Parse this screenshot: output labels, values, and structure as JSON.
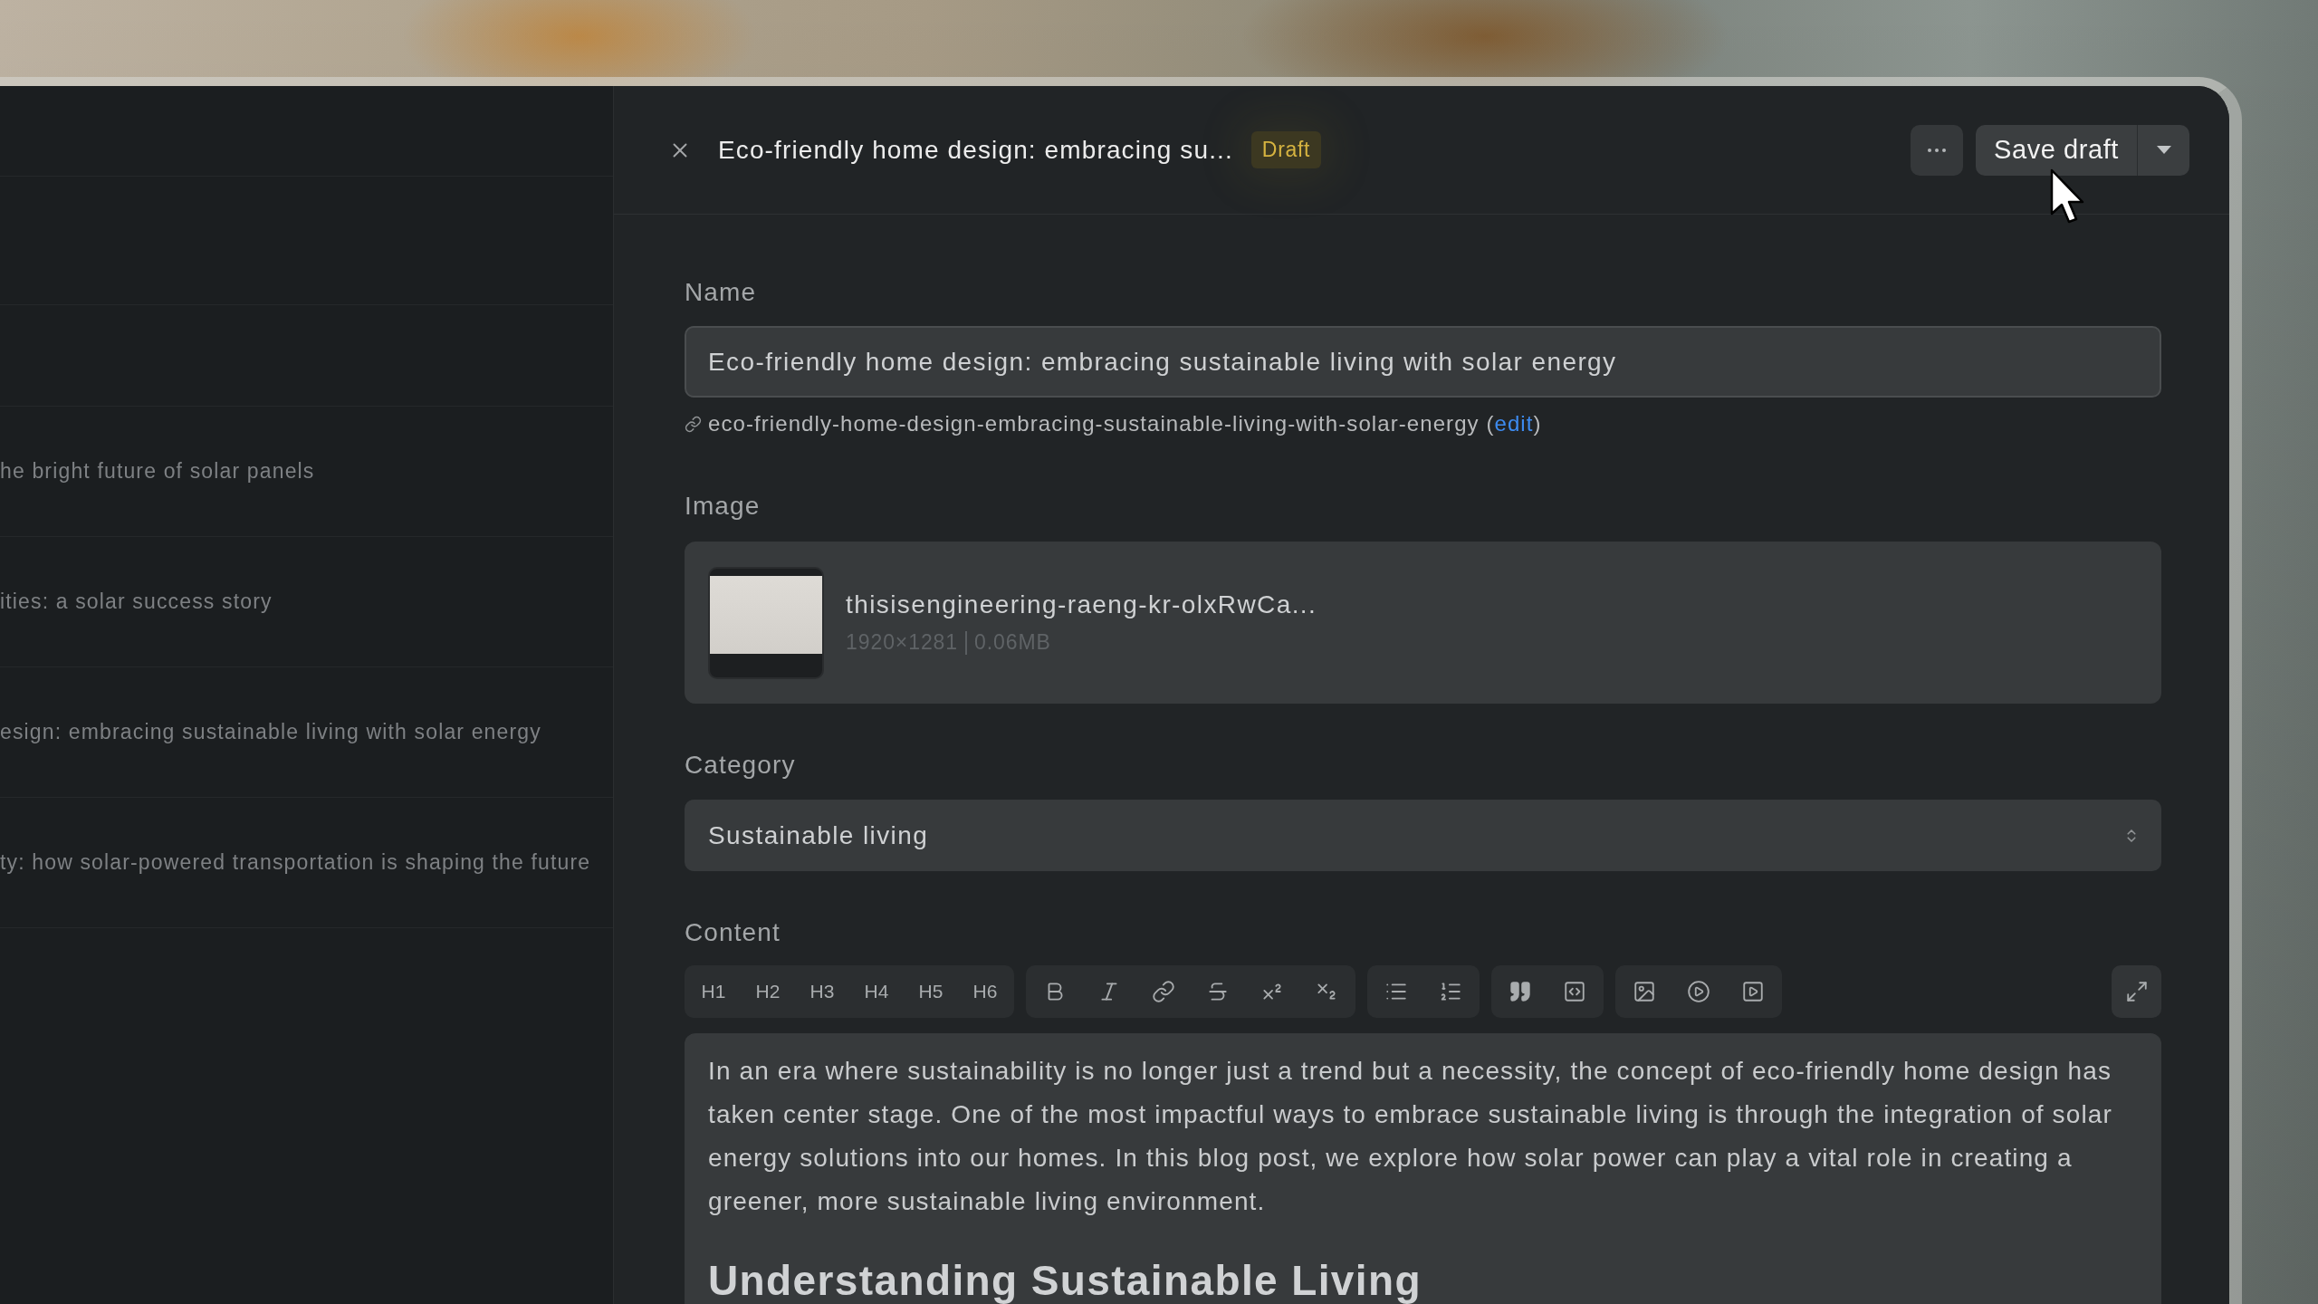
{
  "post_list": {
    "items": [
      {
        "title": "he bright future of solar panels",
        "selected": false
      },
      {
        "title": "ities: a solar success story",
        "selected": false
      },
      {
        "title": "esign: embracing sustainable living with solar energy",
        "selected": false
      },
      {
        "title": "ty: how solar-powered transportation is shaping the future",
        "selected": false
      }
    ]
  },
  "editor": {
    "title": "Eco-friendly home design: embracing su...",
    "status": "Draft",
    "save_label": "Save draft"
  },
  "form": {
    "name": {
      "label": "Name",
      "value": "Eco-friendly home design: embracing sustainable living with solar energy"
    },
    "slug": {
      "text": "eco-friendly-home-design-embracing-sustainable-living-with-solar-energy (",
      "link": "edit",
      "text_end": ")"
    },
    "image": {
      "label": "Image",
      "file_name": "thisisengineering-raeng-kr-olxRwCa...",
      "dimensions": "1920×1281",
      "size": "0.06MB"
    },
    "category": {
      "label": "Category",
      "value": "Sustainable living"
    },
    "content": {
      "label": "Content",
      "heading_buttons": [
        "H1",
        "H2",
        "H3",
        "H4",
        "H5",
        "H6"
      ],
      "paragraph": "In an era where sustainability is no longer just a trend but a necessity, the concept of eco-friendly home design has taken center stage. One of the most impactful ways to embrace sustainable living is through the integration of solar energy solutions into our homes. In this blog post, we explore how solar power can play a vital role in creating a greener, more sustainable living environment.",
      "heading": "Understanding Sustainable Living"
    }
  }
}
